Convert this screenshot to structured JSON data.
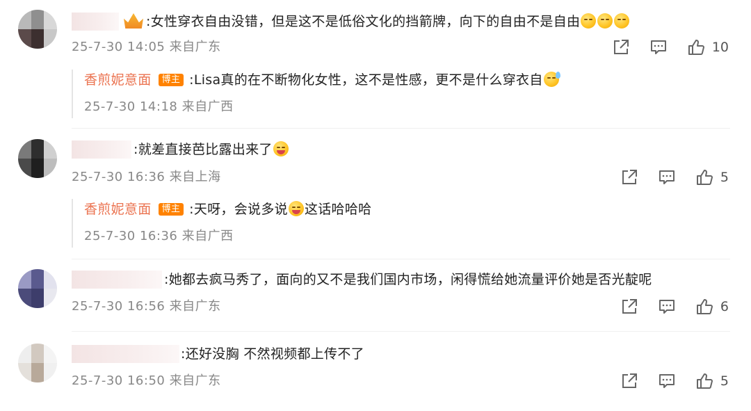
{
  "comments": [
    {
      "text": ":女性穿衣自由没错，但是这不是低俗文化的挡箭牌，向下的自由不是自由",
      "meta": "25-7-30 14:05 来自广东",
      "likes": "10",
      "reply": {
        "name": "香煎妮意面",
        "badge": "博主",
        "text": ":Lisa真的在不断物化女性，这不是性感，更不是什么穿衣自",
        "meta": "25-7-30 14:18 来自广西"
      }
    },
    {
      "text": ":就差直接芭比露出来了",
      "meta": "25-7-30 16:36 来自上海",
      "likes": "5",
      "reply": {
        "name": "香煎妮意面",
        "badge": "博主",
        "text_a": ":天呀，会说多说",
        "text_b": "这话哈哈哈",
        "meta": "25-7-30 16:36 来自广西"
      }
    },
    {
      "text": ":她都去疯马秀了，面向的又不是我们国内市场，闲得慌给她流量评价她是否光靛呢",
      "meta": "25-7-30 16:56 来自广东",
      "likes": "6"
    },
    {
      "text": ":还好没胸 不然视频都上传不了",
      "meta": "25-7-30 16:50 来自广东",
      "likes": "5"
    }
  ],
  "icons": {
    "share": "share-icon",
    "comment": "comment-icon",
    "like": "thumbs-up-icon"
  },
  "colors": {
    "reply_name": "#eb7350",
    "badge_bg": "#ff8200",
    "meta_text": "#888888"
  }
}
